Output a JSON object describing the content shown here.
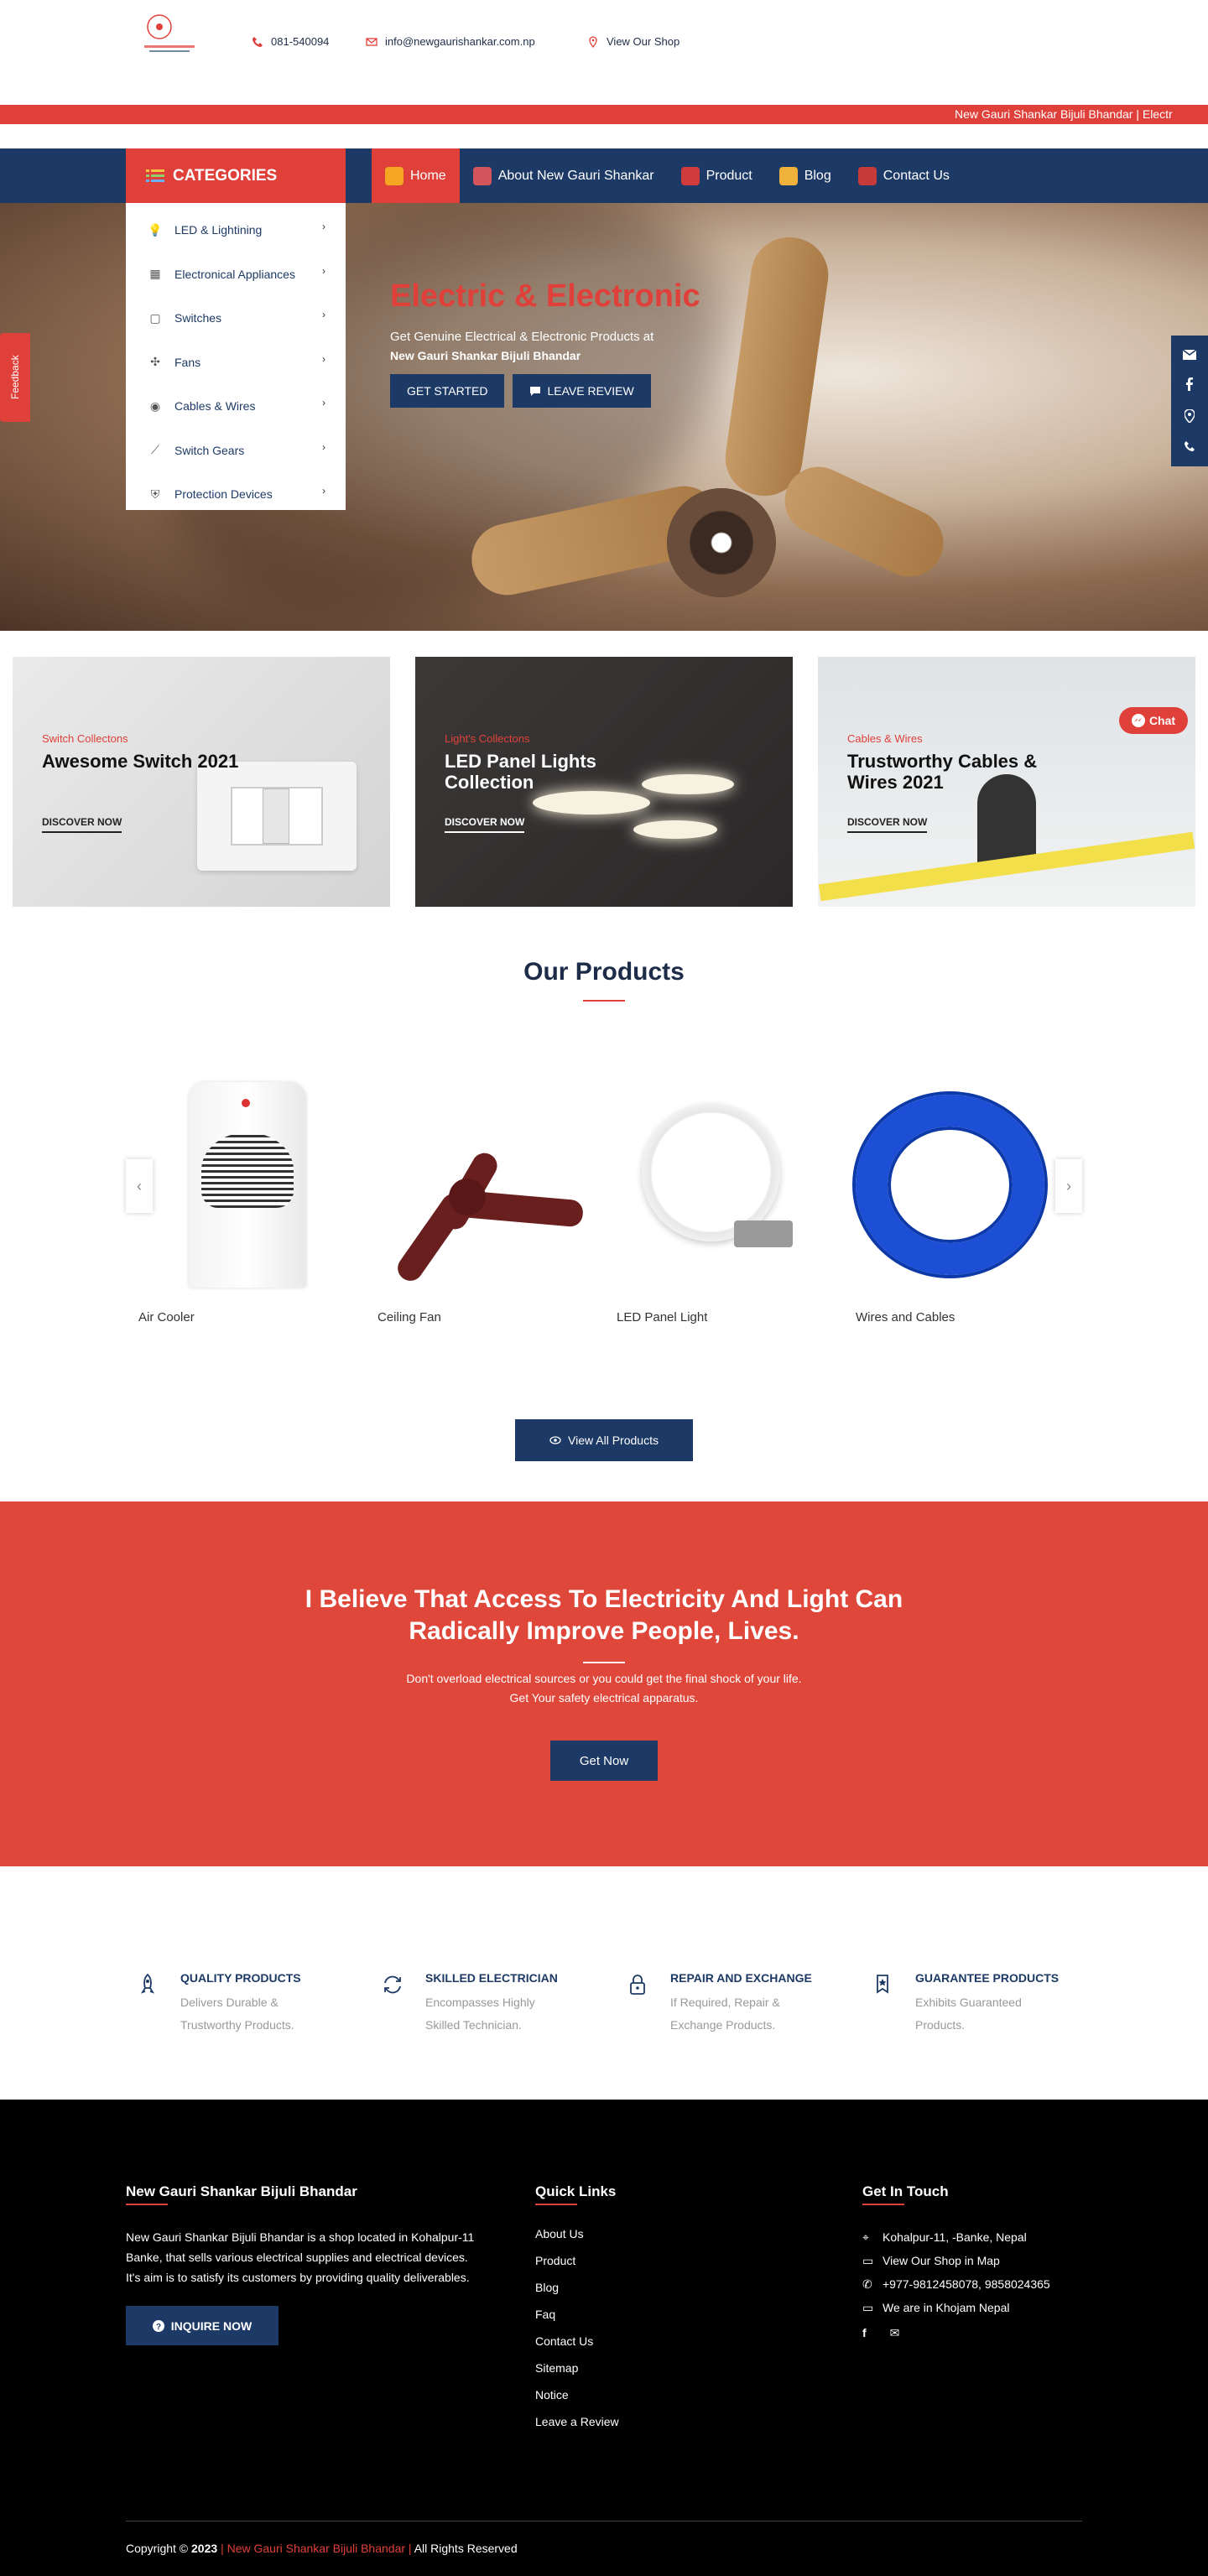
{
  "top": {
    "phone": "081-540094",
    "email": "info@newgaurishankar.com.np",
    "shop_link": "View Our Shop"
  },
  "marquee": "New Gauri Shankar Bijuli Bhandar   |    Electr",
  "categories": {
    "heading": "CATEGORIES",
    "items": [
      {
        "label": "LED & Lightining",
        "icon": "bulb-icon"
      },
      {
        "label": "Electronical Appliances",
        "icon": "appliance-icon"
      },
      {
        "label": "Switches",
        "icon": "switch-icon"
      },
      {
        "label": "Fans",
        "icon": "fan-icon"
      },
      {
        "label": "Cables & Wires",
        "icon": "cable-icon"
      },
      {
        "label": "Switch Gears",
        "icon": "switchgear-icon"
      },
      {
        "label": "Protection Devices",
        "icon": "shield-icon"
      }
    ]
  },
  "nav": {
    "items": [
      {
        "label": "Home",
        "icon": "home-icon"
      },
      {
        "label": "About New Gauri Shankar",
        "icon": "people-icon"
      },
      {
        "label": "Product",
        "icon": "product-icon"
      },
      {
        "label": "Blog",
        "icon": "blog-icon"
      },
      {
        "label": "Contact Us",
        "icon": "contact-icon"
      }
    ]
  },
  "hero": {
    "title": "Electric & Electronic",
    "subtitle": "Get Genuine Electrical & Electronic Products at",
    "shop_name": "New Gauri Shankar Bijuli Bhandar",
    "btn_start": "GET STARTED",
    "btn_review": "LEAVE REVIEW"
  },
  "feedback_tab": "Feedback",
  "collections": [
    {
      "category": "Switch Collectons",
      "title": "Awesome Switch 2021",
      "link": "DISCOVER NOW"
    },
    {
      "category": "Light's Collectons",
      "title": "LED Panel Lights Collection",
      "link": "DISCOVER NOW"
    },
    {
      "category": "Cables & Wires",
      "title": "Trustworthy Cables & Wires 2021",
      "link": "DISCOVER NOW"
    }
  ],
  "chat": "Chat",
  "products": {
    "heading": "Our Products",
    "items": [
      "Air Cooler",
      "Ceiling Fan",
      "LED Panel Light",
      "Wires and Cables"
    ],
    "view_all": "View All Products"
  },
  "band": {
    "heading": "I Believe That Access To Electricity And Light Can Radically Improve People, Lives.",
    "line1": "Don't overload electrical sources or you could get the final shock of your life.",
    "line2": "Get Your safety electrical apparatus.",
    "button": "Get Now"
  },
  "features": [
    {
      "title": "QUALITY PRODUCTS",
      "text": "Delivers Durable & Trustworthy Products.",
      "icon": "rocket-icon"
    },
    {
      "title": "SKILLED ELECTRICIAN",
      "text": "Encompasses Highly Skilled Technician.",
      "icon": "refresh-icon"
    },
    {
      "title": "REPAIR AND EXCHANGE",
      "text": "If Required, Repair & Exchange Products.",
      "icon": "lock-icon"
    },
    {
      "title": "GUARANTEE PRODUCTS",
      "text": "Exhibits Guaranteed Products.",
      "icon": "badge-icon"
    }
  ],
  "footer": {
    "about_title": "New Gauri Shankar Bijuli Bhandar",
    "about_text": "New Gauri Shankar Bijuli Bhandar is a shop located in Kohalpur-11 Banke, that sells various electrical supplies and electrical devices. It's aim is to satisfy its customers by providing quality deliverables.",
    "inquire": "INQUIRE NOW",
    "links_title": "Quick Links",
    "links": [
      "About Us",
      "Product",
      "Blog",
      "Faq",
      "Contact Us",
      "Sitemap",
      "Notice",
      "Leave a Review"
    ],
    "contact_title": "Get In Touch",
    "address": "Kohalpur-11, -Banke, Nepal",
    "map": "View Our Shop in Map",
    "phones": "+977-9812458078, 9858024365",
    "khojam": "We are in Khojam Nepal",
    "copyright_prefix": "Copyright ©",
    "year": "2023",
    "copyright_name": "| New Gauri Shankar Bijuli Bhandar |",
    "rights": "All Rights Reserved"
  }
}
